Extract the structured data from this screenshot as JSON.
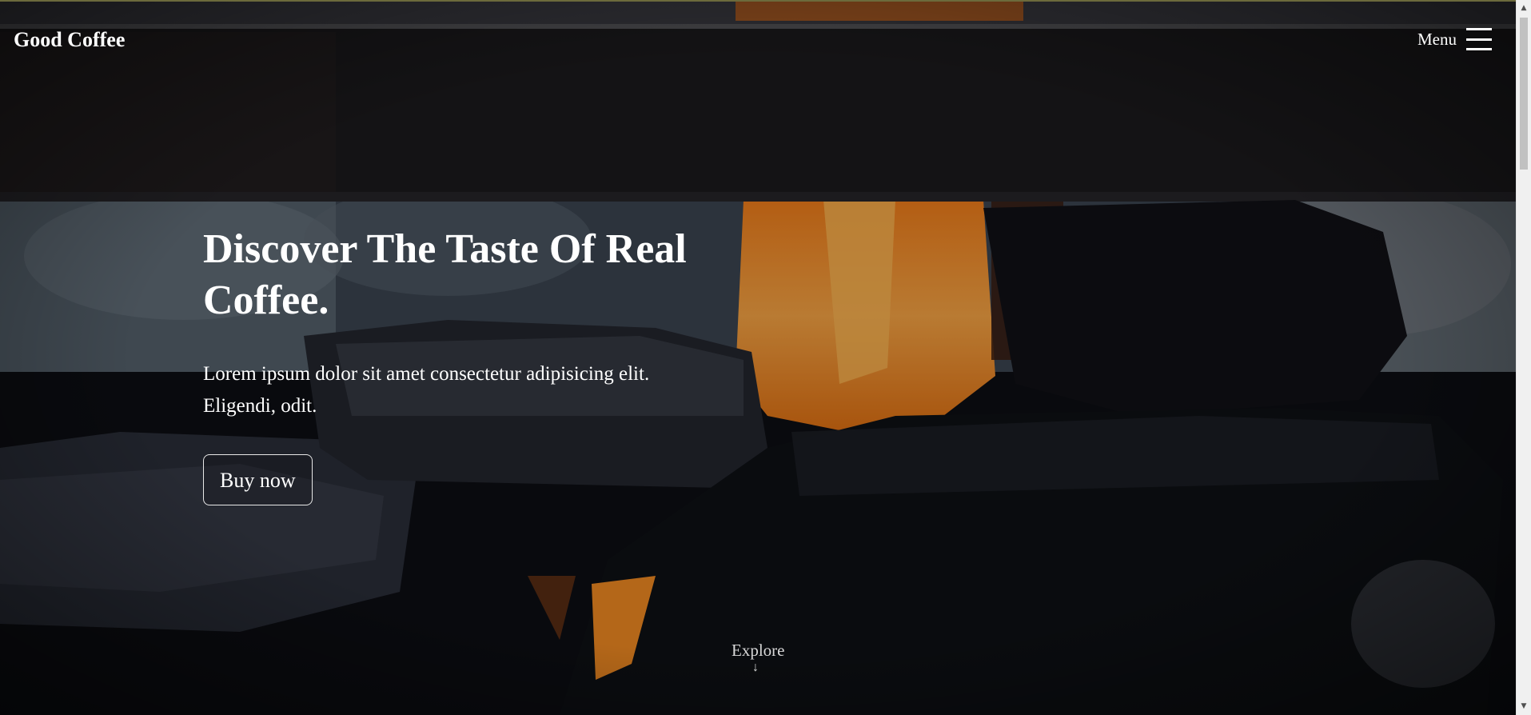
{
  "navbar": {
    "brand": "Good Coffee",
    "menu_label": "Menu",
    "menu_icon": "hamburger-icon"
  },
  "hero": {
    "title": "Discover The Taste Of Real Coffee.",
    "text": "Lorem ipsum dolor sit amet consectetur adipisicing elit. Eligendi, odit.",
    "button_label": "Buy now"
  },
  "explore": {
    "label": "Explore",
    "icon": "arrow-down-icon",
    "arrow_glyph": "↓"
  },
  "scrollbar": {
    "up_glyph": "▲",
    "down_glyph": "▼"
  },
  "colors": {
    "text": "#ffffff",
    "explore_text": "#d8d8d8",
    "flame": "#f5922a",
    "background": "#0c0d12",
    "button_border": "#e8e8e8"
  }
}
